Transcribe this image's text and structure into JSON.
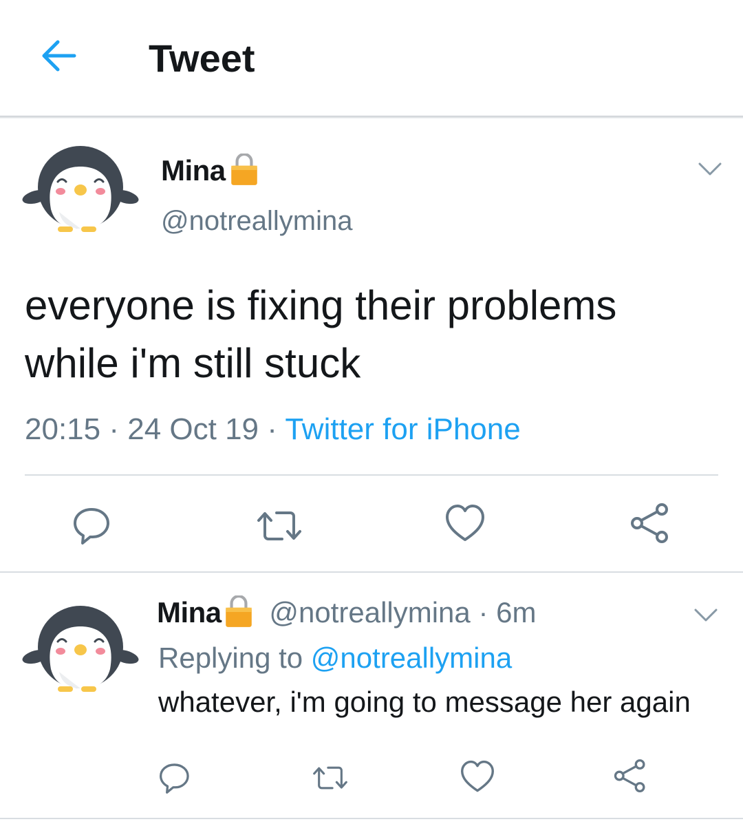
{
  "header": {
    "title": "Tweet",
    "back_icon": "arrow-left-icon",
    "accent_color": "#1da1f2"
  },
  "tweet": {
    "display_name": "Mina",
    "handle": "@notreallymina",
    "text": "everyone is fixing their problems while i'm still stuck",
    "time": "20:15",
    "date": "24 Oct 19",
    "separator": "·",
    "source": "Twitter for iPhone",
    "actions": [
      "reply-icon",
      "retweet-icon",
      "like-icon",
      "share-icon"
    ]
  },
  "reply": {
    "display_name": "Mina",
    "handle": "@notreallymina",
    "separator": "·",
    "age": "6m",
    "replying_label": "Replying to",
    "replying_handle": "@notreallymina",
    "text": "whatever, i'm going to message her again",
    "actions": [
      "reply-icon",
      "retweet-icon",
      "like-icon",
      "share-icon"
    ]
  },
  "colors": {
    "text": "#14171a",
    "secondary": "#657786",
    "link": "#1da1f2",
    "divider": "#d8dde2",
    "lock": "#f5a623"
  }
}
